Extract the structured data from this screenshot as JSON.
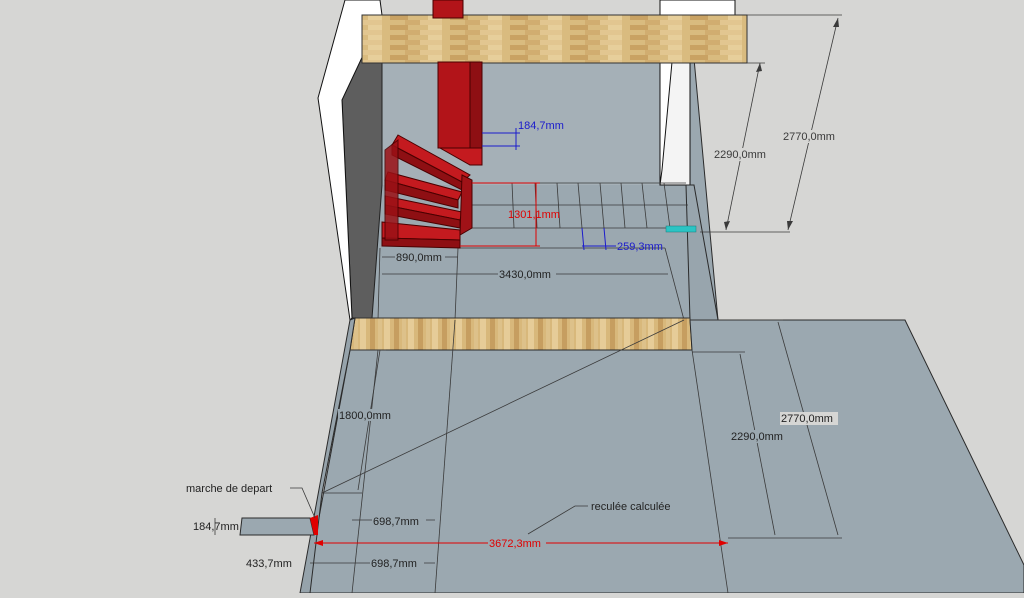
{
  "window": {
    "title": ""
  },
  "dimensions": {
    "stair_riser": "184,7mm",
    "stair_height": "1301,1mm",
    "upper_height_inner": "2290,0mm",
    "upper_height_outer": "2770,0mm",
    "stair_width": "890,0mm",
    "stair_length": "3430,0mm",
    "step_going": "259,3mm",
    "lower_1800": "1800,0mm",
    "lower_height_inner": "2290,0mm",
    "lower_height_outer": "2770,0mm",
    "lower_698_a": "698,7mm",
    "lower_698_b": "698,7mm",
    "lower_433": "433,7mm",
    "lower_184": "184,7mm",
    "reculee_value": "3672,3mm"
  },
  "labels": {
    "marche_de_depart": "marche de depart",
    "reculee_calculee": "reculée calculée"
  },
  "colors": {
    "background": "#d6d6d4",
    "floor": "#9ba8b0",
    "wall_dark": "#5e5e5e",
    "wall_white": "#ffffff",
    "stair_red": "#b21419",
    "wood": "#d7b77a",
    "dim_black": "#3a3a3a",
    "dim_blue": "#1b1bcc",
    "dim_red": "#e00000",
    "accent_cyan": "#2bc4c4"
  }
}
